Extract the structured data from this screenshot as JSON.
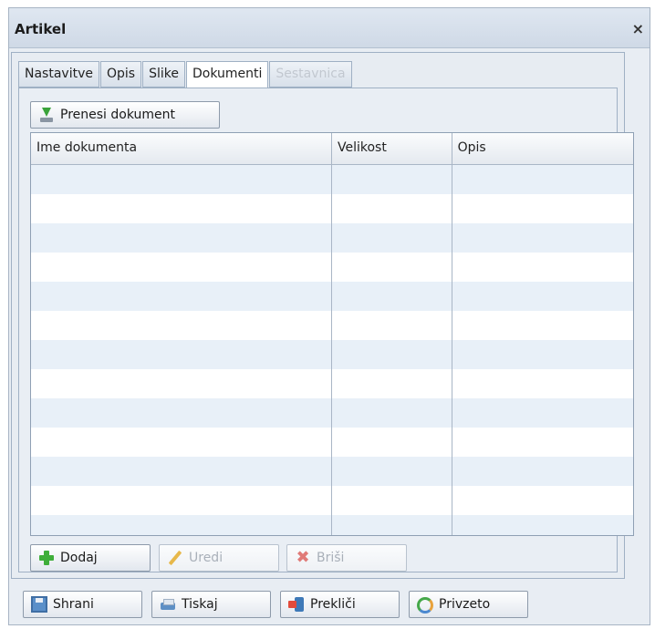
{
  "window": {
    "title": "Artikel",
    "close_glyph": "×"
  },
  "tabs": [
    {
      "label": "Nastavitve",
      "state": "normal"
    },
    {
      "label": "Opis",
      "state": "normal"
    },
    {
      "label": "Slike",
      "state": "normal"
    },
    {
      "label": "Dokumenti",
      "state": "active"
    },
    {
      "label": "Sestavnica",
      "state": "disabled"
    }
  ],
  "documents": {
    "upload_label": "Prenesi dokument",
    "columns": [
      "Ime dokumenta",
      "Velikost",
      "Opis"
    ],
    "rows": [],
    "actions": {
      "add": "Dodaj",
      "edit": "Uredi",
      "delete": "Briši"
    }
  },
  "footer": {
    "save": "Shrani",
    "print": "Tiskaj",
    "cancel": "Prekliči",
    "default": "Privzeto"
  },
  "colors": {
    "row_alt": "#e8f0f8",
    "accent_green": "#3fae3a",
    "border": "#9fb0c4"
  }
}
